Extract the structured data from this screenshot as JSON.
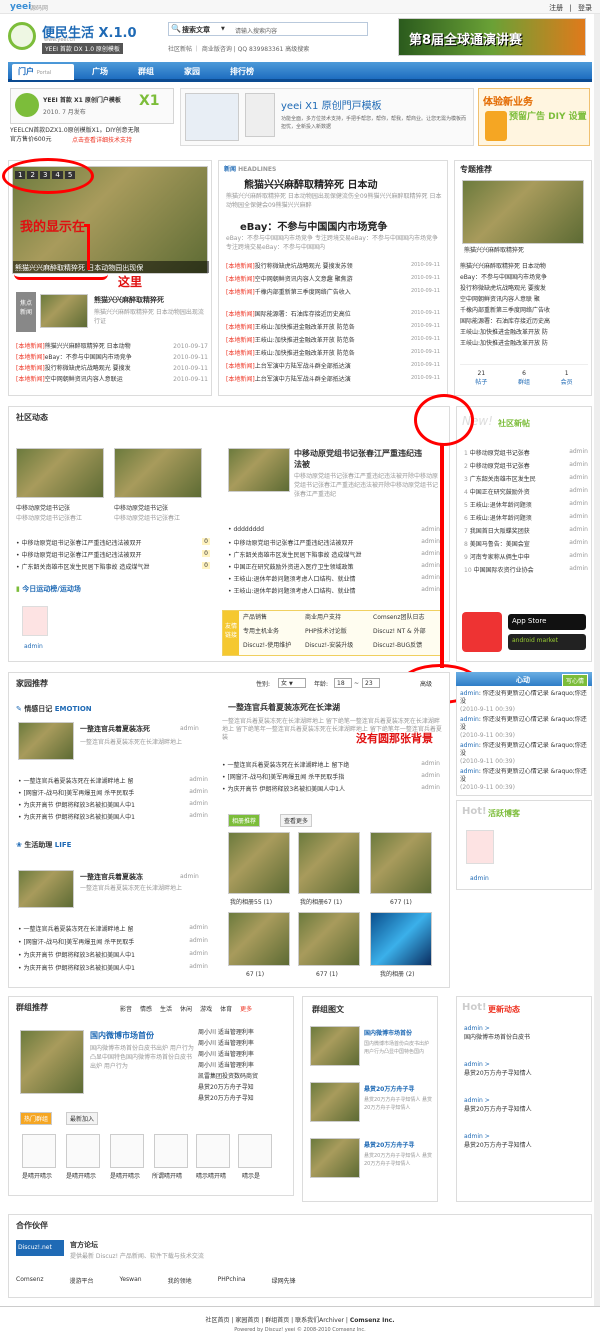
{
  "topbar": {
    "logo": "yeei",
    "logo_small": "源码网",
    "links": [
      "注册",
      "登录"
    ]
  },
  "header": {
    "site_title": "便民生活 X.1.0",
    "site_url": "www.yeei.cn",
    "badge": "YEEI 首款 DX 1.0 原创模板",
    "search_label": "搜索文章",
    "search_placeholder": "请输入搜索内容",
    "search_links": "社区新帖 ｜ 商业版咨询 | QQ 839983361   高级搜索",
    "banner": "第8届全球通演讲赛"
  },
  "nav": {
    "home": "门户",
    "home_sub": "Portal",
    "items": [
      "广场",
      "群组",
      "家园",
      "排行榜"
    ]
  },
  "ads": {
    "ad1_brand": "YEEI 首款 X1 原创门户模板",
    "ad1_date": "2010. 7 月发布",
    "ad1_text1": "YEELCN首款DZX1.0原创模版X1。DIY创意无限",
    "ad1_text2": "官方售价600元",
    "ad1_link": "点击查看详细技术支持",
    "ad2_title": "yeei X1 原创門戸模板",
    "ad2_text": "功能全面，多方位技术支持，手把手帮您，帮你，帮我，帮商业。让您无需为模板而担忧，全新投入新数据",
    "ad3_title": "体验新业务",
    "ad3_sub": "预留广告 DIY 设置"
  },
  "headline": {
    "slide_nums": [
      "1",
      "2",
      "3",
      "4",
      "5"
    ],
    "slide_caption": "熊猫兴兴麻醉取精猝死 日本动物园出现保",
    "annot1": "我的显示在",
    "annot2": "这里",
    "side_title": "熊猫兴兴麻醉取精猝死",
    "side_desc": "熊猫兴兴麻醉取精猝死 日本动物园出现流行证",
    "list": [
      {
        "tag": "[本地新闻]",
        "text": "熊猫兴兴麻醉取精猝死 日本动物",
        "date": "2010-09-17"
      },
      {
        "tag": "[本地新闻]",
        "text": "eBay：不参与中国国内市场竞争",
        "date": "2010-09-11"
      },
      {
        "tag": "[本地新闻]",
        "text": "投行称微缺虎坑战略观光 要搜发",
        "date": "2010-09-11"
      },
      {
        "tag": "[本地新闻]",
        "text": "空中网朝鲜资讯内容人意联运",
        "date": "2010-09-11"
      }
    ]
  },
  "news": {
    "label": "新闻",
    "tag": "HEADLINES",
    "title1": "熊猫兴兴麻醉取精猝死  日本动",
    "desc1": "熊猫兴兴麻醉取精猝死 日本动物园出现保健流伤全09熊猫兴兴麻醉取精猝死 日本动物园全保健会09熊猫兴兴麻醉",
    "title2": "eBay：不参与中国国内市场竞争",
    "desc2": "eBay：不参与中国国内市场竞争 专注跨境交易eBay：不参与中国国内市场竞争 专注跨境交易eBay：不参与中国国内",
    "list1": [
      {
        "tag": "[本地新闻]",
        "text": "投行称微缺虎坑战略观光 要搜发苏领",
        "date": "2010-09-11"
      },
      {
        "tag": "[本地新闻]",
        "text": "空中网朝鲜资讯内容人文意趣 聚焦游",
        "date": "2010-09-11"
      },
      {
        "tag": "[本地新闻]",
        "text": "千橡内部重新第三季度网络广告收入",
        "date": "2010-09-11"
      }
    ],
    "list2": [
      {
        "tag": "[本地新闻]",
        "text": "国际能源署：石油库存接近历史高位",
        "date": "2010-09-11"
      },
      {
        "tag": "[本地新闻]",
        "text": "王岐山:加快推进金融改革开放 防范各",
        "date": "2010-09-11"
      },
      {
        "tag": "[本地新闻]",
        "text": "王岐山:加快推进金融改革开放 防范各",
        "date": "2010-09-11"
      },
      {
        "tag": "[本地新闻]",
        "text": "王岐山:加快推进金融改革开放 防范各",
        "date": "2010-09-11"
      },
      {
        "tag": "[本地新闻]",
        "text": "上台军演中方陆军战斗群全部抵达演",
        "date": "2010-09-11"
      },
      {
        "tag": "[本地新闻]",
        "text": "上台军演中方陆军战斗群全部抵达演",
        "date": "2010-09-11"
      }
    ]
  },
  "special": {
    "title": "专题推荐",
    "caption": "熊猫兴兴麻醉取精猝死",
    "items": [
      "熊猫兴兴麻醉取精猝死 日本动物",
      "eBay：不参与中国国内市场竞争",
      "投行称微缺虎坑战略观光 要搜发",
      "空中网朝鲜资讯内容人意联 聚",
      "千橡内部重新第三季度网络广告收",
      "国际能源署：石油库存接近历史高",
      "王岐山:加快推进金融改革开放 防",
      "王岐山:加快推进金融改革开放 防"
    ],
    "stats": [
      {
        "num": "21",
        "label": "帖子"
      },
      {
        "num": "6",
        "label": "群组"
      },
      {
        "num": "1",
        "label": "会员"
      }
    ]
  },
  "community": {
    "title": "社区动态",
    "thumbs": [
      {
        "title": "中移动原党组书记张",
        "desc": "中移动原党组书记张春江"
      },
      {
        "title": "中移动原党组书记张",
        "desc": "中移动原党组书记张春江"
      }
    ],
    "feat_title": "中移动原党组书记张春江严重违纪违法被",
    "feat_desc": "中移动原党组书记张春江严重违纪违法被开除中移动原党组书记张春江严重违纪违法被开除中移动原党组书记张春江严重违纪",
    "list_left": [
      {
        "text": "中移动原党组书记张春江严重违纪违法被双开",
        "num": "0"
      },
      {
        "text": "中移动原党组书记张春江严重违纪违法被双开",
        "num": "0"
      },
      {
        "text": "广东韶关南雄市区发生民居下陷事故 造成煤气泄",
        "num": "0"
      }
    ],
    "list_right": [
      {
        "text": "dddddddd",
        "user": "admin"
      },
      {
        "text": "中移动原党组书记张春江严重违纪违法被双开",
        "user": "admin"
      },
      {
        "text": "广东韶关南雄市区发生民居下陷事故 造成煤气泄",
        "user": "admin"
      },
      {
        "text": "中国正在研究鼓励外资进入医疗卫生领域政策",
        "user": "admin"
      },
      {
        "text": "王岐山:退休年龄问题须考虑人口结构、就业情",
        "user": "admin"
      },
      {
        "text": "王岐山:退休年龄问题须考虑人口结构、就业情",
        "user": "admin"
      }
    ],
    "today": "今日运动榜/运动场",
    "avatar_user": "admin",
    "friends_label": "友情链接",
    "friends": [
      "产品销售",
      "商业用户支持",
      "Comsenz团队日志",
      "专用主机业务",
      "PHP技术讨论版",
      "Discuz! NT & 外部",
      "Discuz!-使用维护",
      "Discuz!-安装升级",
      "Discuz!-BUG反馈"
    ],
    "side_title": "社区新帖",
    "side_items": [
      "中移动原党组书记张春",
      "中移动原党组书记张春",
      "广东韶关南雄市区发生民",
      "中国正在研究鼓励外资",
      "王岐山:退休年龄问题须",
      "王岐山:退休年龄问题须",
      "我国首日大阪蝶奖团获",
      "美国马鲁告：美国会宣",
      "河南专家称从俩生中申",
      "中国国际农资行业协会"
    ],
    "side_user": "admin",
    "app_store": "App Store",
    "android": "android market"
  },
  "family": {
    "title": "家园推荐",
    "gender_label": "性别:",
    "gender_value": "女",
    "age_label": "年龄:",
    "age_from": "18",
    "age_to": "23",
    "search_btn": "高级",
    "emotion_label": "情感日记",
    "emotion_en": "EMOTION",
    "emo_title": "一整连官兵着夏装冻死",
    "emo_desc": "一整连官兵着夏装冻死在长津湖畔地上",
    "emo_user": "admin",
    "emo_list": [
      {
        "text": "一整连官兵着夏装冻死在长津湖畔地上 留",
        "user": "admin"
      },
      {
        "text": "[网窗汗-战马和]美军再爆丑闻 杀平民取手",
        "user": "admin"
      },
      {
        "text": "为庆开高节 伊朗将释放3名被扣美国人中1",
        "user": "admin"
      },
      {
        "text": "为庆开高节 伊朗将释放3名被扣美国人中1",
        "user": "admin"
      }
    ],
    "life_label": "生活助理",
    "life_en": "LIFE",
    "life_title": "一整连官兵着夏装冻",
    "life_desc": "一整连官兵着夏装冻死在长津湖畔地上",
    "life_user": "admin",
    "life_list": [
      {
        "text": "一整连官兵着夏装冻死在长津湖畔地上 留",
        "user": "admin"
      },
      {
        "text": "[网窗汗-战马和]美军再爆丑闻 杀平民取手",
        "user": "admin"
      },
      {
        "text": "为庆开高节 伊朗将释放3名被扣美国人中1",
        "user": "admin"
      },
      {
        "text": "为庆开高节 伊朗将释放3名被扣美国人中1",
        "user": "admin"
      }
    ],
    "center_title": "一整连官兵着夏装冻死在长津湖",
    "center_desc": "一整连官兵着夏装冻死在长津湖畔地上 留下绝笔一整连官兵着夏装冻死在长津湖畔地上 留下绝笔年一整连官兵着夏装冻死在长津湖畔地上 留下绝笔年一整连官兵着夏装",
    "center_list": [
      {
        "text": "一整连官兵着夏装冻死在长津湖畔地上 留下绝",
        "user": "admin"
      },
      {
        "text": "[网窗汗-战马和]美军再爆丑闻 杀平民取手指",
        "user": "admin"
      },
      {
        "text": "为庆开高节 伊朗将释放3名被扣美国人中1人",
        "user": "admin"
      }
    ],
    "photo_tabs": [
      "相册推荐",
      "查看更多"
    ],
    "photos": [
      "我的相册55 (1)",
      "我的相册67 (1)",
      "677 (1)",
      "67 (1)",
      "677 (1)",
      "我的相册 (2)"
    ],
    "mood_title": "心动",
    "mood_btn": "写心情",
    "moods": [
      {
        "user": "admin",
        "text": ": 你还没有更新过心情记录 &raquo;你还没",
        "time": "(2010-9-11 00:39)"
      },
      {
        "user": "admin",
        "text": ": 你还没有更新过心情记录 &raquo;你还没",
        "time": "(2010-9-11 00:39)"
      },
      {
        "user": "admin",
        "text": ": 你还没有更新过心情记录 &raquo;你还没",
        "time": "(2010-9-11 00:39)"
      },
      {
        "user": "admin",
        "text": ": 你还没有更新过心情记录 &raquo;你还没",
        "time": "(2010-9-11 00:39)"
      }
    ],
    "active_title": "活跃博客",
    "active_user": "admin",
    "annot3": "没有圆那张背景"
  },
  "groups": {
    "title": "群组推荐",
    "cats": [
      "影音",
      "情感",
      "生活",
      "休闲",
      "游戏",
      "体育",
      "更多"
    ],
    "feat_title": "国内微博市场首份",
    "feat_desc": "国内微博市场首份白皮书出炉 用户行为凸显中国特色国内微博市场首份白皮书出炉 用户行为",
    "list": [
      "周小川 适当管理利率",
      "周小川 适当管理利率",
      "周小川 适当管理利率",
      "周小川 适当管理利率",
      "凯雷集团投资数码商贸",
      "悬赏20万方舟子寻知",
      "悬赏20万方舟子寻知"
    ],
    "tabs": [
      "热门群组",
      "最新加入"
    ],
    "icons": [
      "是晴开晴示",
      "是晴开晴示",
      "是晴开晴示",
      "所谓晴开晴",
      "晴示晴开晴",
      "晴示是"
    ],
    "pic_title": "群组图文",
    "pics": [
      {
        "title": "国内微博市场首份",
        "desc": "国内微博市场首份白皮书出炉 用户行为凸显中国特色国内"
      },
      {
        "title": "悬赏20万方舟子寻",
        "desc": "悬赏20万方舟子寻知情人 悬赏20万方舟子寻知情人"
      },
      {
        "title": "悬赏20万方舟子寻",
        "desc": "悬赏20万方舟子寻知情人 悬赏20万方舟子寻知情人"
      },
      {
        "title": "悬赏20万方舟子寻",
        "desc": "悬赏20万方舟子寻知情人 悬赏20万方舟子寻知情人"
      }
    ],
    "hot_title": "更新动态",
    "hot": [
      {
        "user": "admin >",
        "text": "国内微博市场首份白皮书"
      },
      {
        "user": "admin >",
        "text": "悬赏20万方舟子寻知情人"
      },
      {
        "user": "admin >",
        "text": "悬赏20万方舟子寻知情人"
      },
      {
        "user": "admin >",
        "text": "悬赏20万方舟子寻知情人"
      }
    ]
  },
  "partners": {
    "title": "合作伙伴",
    "logo": "Discuz!.net",
    "feat_title": "官方论坛",
    "feat_desc": "提供最新 Discuz! 产品新闻、软件下载与技术交流",
    "links": [
      "Comsenz",
      "漫游平台",
      "Yeswan",
      "我的领地",
      "PHPchina",
      "绿网先锋"
    ]
  },
  "footer": {
    "links": [
      "社区首页",
      "家园首页",
      "群组首页",
      "联系我们Archiver",
      "Comsenz Inc."
    ],
    "copy": "Powered by Discuz! yeei © 2008-2010 Comsenz Inc."
  }
}
